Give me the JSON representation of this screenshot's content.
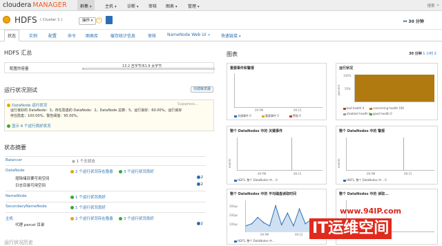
{
  "topnav": {
    "logo_main": "cloudera",
    "logo_sub": "MANAGER",
    "items": [
      "群集",
      "主机",
      "诊断",
      "审核",
      "图表",
      "管理"
    ],
    "search_placeholder": "搜索"
  },
  "service": {
    "name": "HDFS",
    "cluster": "( Cluster 1 )",
    "actions_label": "操作",
    "time_range": "30 分钟"
  },
  "tabs": [
    "状态",
    "实例",
    "配置",
    "命令",
    "图表库",
    "缓存统计信息",
    "审核",
    "NameNode Web UI",
    "快速链接"
  ],
  "summary": {
    "title": "HDFS 汇总",
    "capacity_label": "配置的容量",
    "capacity_value": "13.2 吉字节/61.9 太字节",
    "capacity_fraction": 0.0002
  },
  "health_test": {
    "title": "运行状况测试",
    "create_trigger": "创建触发器",
    "item_title": "DataNode 运行状况",
    "item_suppress": "Suppress...",
    "item_body_1": "运行良好的 DataNode：3。存在隐患的 DataNode：2。DataNode 总数：5。运行良好：60.00%。运行良好",
    "item_body_2": "存在隐患：100.00%。警告阈值：95.00%。",
    "show_more": "显示 6 个运行良好状况"
  },
  "status_summary": {
    "title": "状态摘要",
    "rows": [
      {
        "name": "Balancer",
        "status": "1 个无状态"
      },
      {
        "name": "DataNode",
        "concerning": "2 个运行状况存在隐患",
        "good": "3 个运行状况良好"
      },
      {
        "name": "增除储目要可用空间",
        "count": "2"
      },
      {
        "name": "日志目录可用空间",
        "count": "2"
      },
      {
        "name": "NameNode",
        "good": "1 个运行状况良好"
      },
      {
        "name": "SecondaryNameNode",
        "good": "1 个运行状况良好"
      },
      {
        "name": "主机",
        "concerning": "2 个运行状况存在隐患",
        "good": "3 个运行状况良好"
      },
      {
        "name": "代理 parcel 目录",
        "count": "2"
      }
    ],
    "cut_title": "运行状况历史"
  },
  "charts_header": {
    "title": "图表",
    "range_30m": "30 分钟",
    "range_1h": "1 小时",
    "range_2h": "2"
  },
  "panels": {
    "p1": {
      "title": "重要事件和警报",
      "x_ticks": [
        "09 PM",
        "09:15"
      ],
      "legend": [
        "关键事件 0",
        "重要事件 0",
        "警报 0"
      ]
    },
    "p2": {
      "title": "运行状况",
      "y_label": "percent",
      "y_ticks": [
        "100%",
        "50%"
      ],
      "legend": [
        "bad health 0",
        "concerning health 100",
        "disabled health 0",
        "good health 0"
      ]
    },
    "p3": {
      "title": "整个 DataNodes 中的 关键事件",
      "y_label": "events",
      "x_ticks": [
        "09 PM",
        "09:15"
      ],
      "legend": "HDFS, 整个 DataNodes 中... 0"
    },
    "p4": {
      "title": "整个 DataNodes 中的 警报",
      "y_label": "events",
      "x_ticks": [
        "09 PM",
        "09:15"
      ],
      "legend": "HDFS, 整个 DataNodes 中... 0"
    },
    "p5": {
      "title": "整个 DataNodes 中的 平均磁盘读取时间",
      "y_ticks": [
        "300μs",
        "200μs",
        "100μs"
      ],
      "x_ticks": [
        "09 PM",
        "09:15"
      ],
      "legend": "HDFS, 整个 DataNodes 中..."
    },
    "p6": {
      "title": "整个 DataNodes 中的 读取...",
      "y_label": "ms"
    }
  },
  "chart_data": [
    {
      "type": "line",
      "title": "重要事件和警报",
      "x": [
        "09 PM",
        "09:15"
      ],
      "series": [
        {
          "name": "关键事件",
          "values": [
            0,
            0
          ]
        },
        {
          "name": "重要事件",
          "values": [
            0,
            0
          ]
        },
        {
          "name": "警报",
          "values": [
            0,
            0
          ]
        }
      ]
    },
    {
      "type": "area",
      "title": "运行状况",
      "ylabel": "percent",
      "ylim": [
        0,
        100
      ],
      "series": [
        {
          "name": "concerning health",
          "values": [
            100,
            100,
            100,
            100
          ]
        }
      ]
    },
    {
      "type": "line",
      "title": "整个 DataNodes 中的 平均磁盘读取时间",
      "ylim": [
        0,
        300
      ],
      "series": [
        {
          "name": "HDFS, 整个 DataNodes 中...",
          "values": [
            60,
            80,
            140,
            90,
            60,
            250,
            70,
            180,
            60,
            220,
            80,
            120,
            60,
            40
          ]
        }
      ]
    }
  ],
  "watermark": {
    "site": "www.94IP.com",
    "brand": "IT运维空间"
  },
  "colors": {
    "accent": "#2870b0",
    "concerning": "#e0a800",
    "good": "#38a838",
    "health_fill": "#b07a10",
    "logo_orange": "#f05a22"
  }
}
